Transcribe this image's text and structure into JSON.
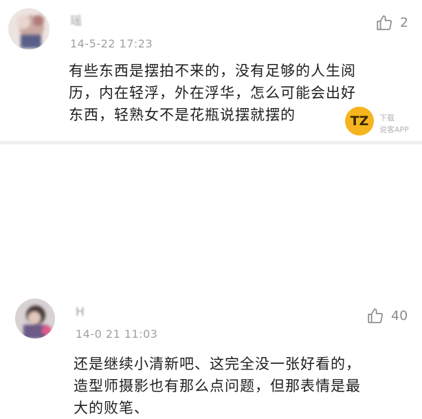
{
  "comments": [
    {
      "username": "瑶",
      "time": "14-5-22 17:23",
      "likes": "2",
      "text_lines": [
        "有些东西是摆拍不来的，没有足够的人生阅",
        "历，内在轻浮，外在浮华，怎么可能会出好",
        "东西，轻熟女不是花瓶说摆就摆的"
      ],
      "like_icon": "thumbs-up-icon",
      "avatar_icon": "avatar-icon"
    },
    {
      "username": "H",
      "time": "14-0 21 11:03",
      "likes": "40",
      "text_lines": [
        "还是继续小清新吧、这完全没一张好看的，",
        "造型师摄影也有那么点问题，但那表情是最",
        "大的败笔、"
      ],
      "like_icon": "thumbs-up-icon",
      "avatar_icon": "avatar-icon"
    }
  ],
  "watermark": {
    "logo_text": "TZ",
    "line1": "下载",
    "line2": "说客APP",
    "color": "#f6b51e"
  }
}
